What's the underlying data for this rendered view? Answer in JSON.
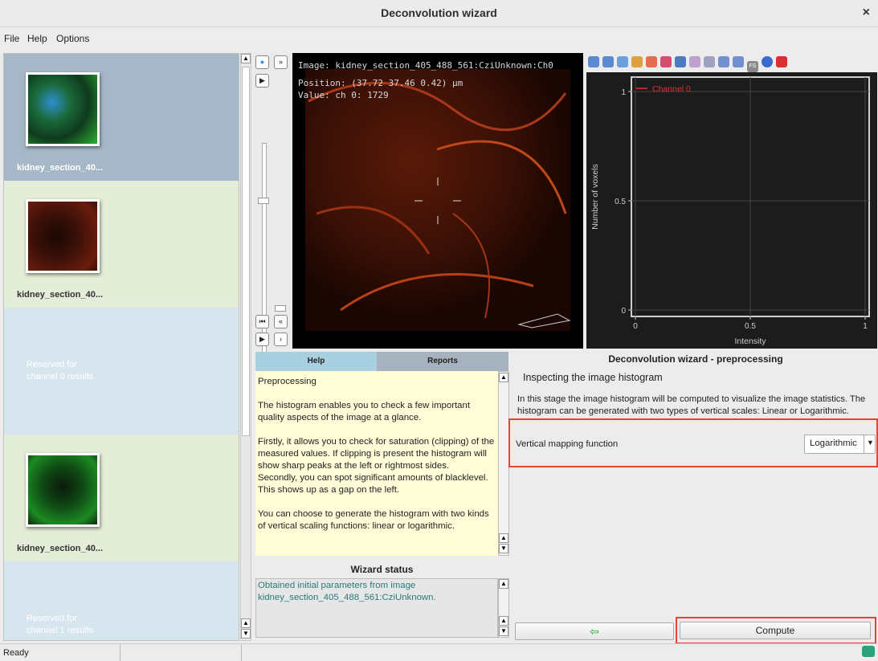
{
  "window": {
    "title": "Deconvolution wizard",
    "close_glyph": "×"
  },
  "menu": {
    "file": "File",
    "help": "Help",
    "options": "Options"
  },
  "thumbnails": [
    {
      "label": "kidney_section_40...",
      "selected": true
    },
    {
      "label": "kidney_section_40...",
      "selected": false
    },
    {
      "reserved": "Reserved for\nchannel 0 results"
    },
    {
      "label": "kidney_section_40...",
      "selected": false
    },
    {
      "reserved": "Reserved for\nchannel 1 results"
    }
  ],
  "image_view": {
    "image_line": "Image: kidney_section_405_488_561:CziUnknown:Ch0",
    "position_line": "Position: (37.72 37.46 0.42) μm",
    "value_line": "Value: ch 0: 1729"
  },
  "histogram": {
    "toolbar_icons": [
      "zoom-in-icon",
      "zoom-out-icon",
      "zoom-fit-icon",
      "axis-icon",
      "palette-icon",
      "curve-icon",
      "chart-icon",
      "tag-icon",
      "tag-remove-icon",
      "table-icon",
      "export-icon",
      "fs-icon",
      "help-icon",
      "close-icon"
    ],
    "fs_label": "FS",
    "close_color": "#d83030",
    "chart_data": {
      "type": "line",
      "series": [
        {
          "name": "Channel 0",
          "color": "#e03030",
          "values": []
        }
      ],
      "xlabel": "Intensity",
      "ylabel": "Number of voxels",
      "xlim": [
        0,
        1
      ],
      "ylim": [
        0,
        1
      ],
      "xticks": [
        "0",
        "0.5",
        "1"
      ],
      "yticks": [
        "0",
        "0.5",
        "1"
      ],
      "grid": true,
      "legend": "top-left"
    }
  },
  "tabs": {
    "help": "Help",
    "reports": "Reports"
  },
  "help_text": {
    "heading": "Preprocessing",
    "p1": "The histogram enables you to check a few important quality aspects of the image at a glance.",
    "p2a": "Firstly, it allows you to check for saturation (clipping) of the measured values. If clipping is present the histogram will show sharp peaks at the left or rightmost sides.",
    "p2b": "Secondly, you can spot significant amounts of blacklevel. This shows up as a gap on the left.",
    "p3": "You can choose to generate the histogram with two kinds of vertical scaling functions: linear or logarithmic."
  },
  "wizard": {
    "header": "Deconvolution wizard - preprocessing",
    "step_title": "Inspecting the image histogram",
    "description": "In this stage the image histogram will be computed to visualize the image statistics. The histogram can be generated with two types of vertical scales: Linear or Logarithmic.",
    "mapping_label": "Vertical mapping function",
    "mapping_value": "Logarithmic",
    "back_glyph": "⇦",
    "compute": "Compute"
  },
  "wizard_status": {
    "title": "Wizard status",
    "text": "Obtained initial parameters from image kidney_section_405_488_561:CziUnknown."
  },
  "status": {
    "text": "Ready"
  }
}
